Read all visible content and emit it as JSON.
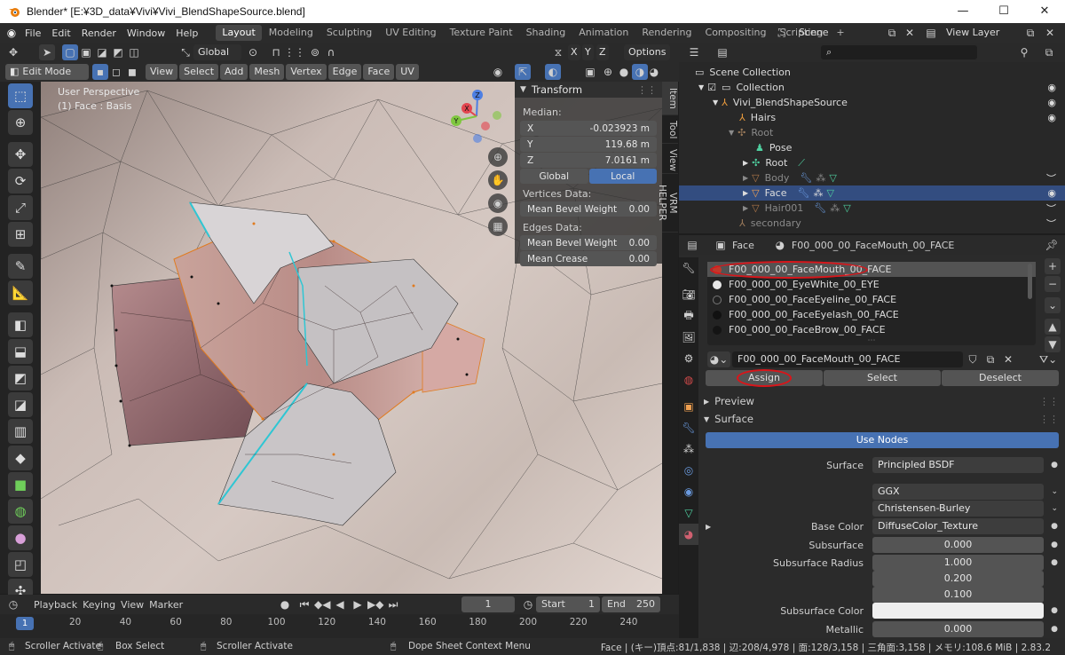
{
  "window": {
    "title": "Blender* [E:¥3D_data¥Vivi¥Vivi_BlendShapeSource.blend]",
    "controls": [
      "—",
      "☐",
      "✕"
    ]
  },
  "topbar": {
    "menus": [
      "File",
      "Edit",
      "Render",
      "Window",
      "Help"
    ],
    "workspaces": [
      "Layout",
      "Modeling",
      "Sculpting",
      "UV Editing",
      "Texture Paint",
      "Shading",
      "Animation",
      "Rendering",
      "Compositing",
      "Scripting"
    ],
    "active_workspace": "Layout",
    "add_tab": "+",
    "scene_label": "Scene",
    "view_layer_label": "View Layer"
  },
  "viewport_header": {
    "orientation": "Global",
    "options": "Options",
    "axes": [
      "X",
      "Y",
      "Z"
    ],
    "mode": "Edit Mode",
    "menus": [
      "View",
      "Select",
      "Add",
      "Mesh",
      "Vertex",
      "Edge",
      "Face",
      "UV"
    ]
  },
  "viewport": {
    "overlay_title": "User Perspective",
    "overlay_sub": "(1) Face : Basis",
    "gizmo": {
      "z": "Z",
      "x": "X",
      "y": "Y"
    }
  },
  "npanel": {
    "header": "Transform",
    "median_label": "Median:",
    "fields": [
      {
        "axis": "X",
        "value": "-0.023923 m"
      },
      {
        "axis": "Y",
        "value": "119.68 m"
      },
      {
        "axis": "Z",
        "value": "7.0161 m"
      }
    ],
    "space_global": "Global",
    "space_local": "Local",
    "vertices_data_label": "Vertices Data:",
    "vertex_bevel": {
      "label": "Mean Bevel Weight",
      "value": "0.00"
    },
    "edges_data_label": "Edges Data:",
    "edge_bevel": {
      "label": "Mean Bevel Weight",
      "value": "0.00"
    },
    "edge_crease": {
      "label": "Mean Crease",
      "value": "0.00"
    },
    "tabs": [
      "Item",
      "Tool",
      "View",
      "VRM HELPER"
    ]
  },
  "outliner": {
    "rows": [
      {
        "label": "Scene Collection",
        "indent": 0,
        "icon": "collection-icon",
        "dim": false
      },
      {
        "label": "Collection",
        "indent": 1,
        "icon": "collection-icon",
        "dim": false
      },
      {
        "label": "Vivi_BlendShapeSource",
        "indent": 2,
        "icon": "empty-icon",
        "dim": false
      },
      {
        "label": "Hairs",
        "indent": 3,
        "icon": "empty-icon",
        "dim": false
      },
      {
        "label": "Root",
        "indent": 3,
        "icon": "armature-icon",
        "dim": true
      },
      {
        "label": "Pose",
        "indent": 4,
        "icon": "pose-icon",
        "dim": false
      },
      {
        "label": "Root",
        "indent": 4,
        "icon": "armature-icon",
        "dim": false
      },
      {
        "label": "Body",
        "indent": 4,
        "icon": "mesh-icon",
        "dim": true
      },
      {
        "label": "Face",
        "indent": 4,
        "icon": "mesh-icon",
        "dim": false,
        "selected": true
      },
      {
        "label": "Hair001",
        "indent": 4,
        "icon": "mesh-icon",
        "dim": true
      },
      {
        "label": "secondary",
        "indent": 3,
        "icon": "empty-icon",
        "dim": true
      }
    ]
  },
  "properties": {
    "breadcrumb_object": "Face",
    "breadcrumb_material": "F00_000_00_FaceMouth_00_FACE",
    "slots": [
      {
        "name": "F00_000_00_FaceMouth_00_FACE",
        "color": "#c0392b"
      },
      {
        "name": "F00_000_00_EyeWhite_00_EYE",
        "color": "#e8e8e8"
      },
      {
        "name": "F00_000_00_FaceEyeline_00_FACE",
        "color": "#222222"
      },
      {
        "name": "F00_000_00_FaceEyelash_00_FACE",
        "color": "#111111"
      },
      {
        "name": "F00_000_00_FaceBrow_00_FACE",
        "color": "#141414"
      }
    ],
    "material_name": "F00_000_00_FaceMouth_00_FACE",
    "assign": "Assign",
    "select": "Select",
    "deselect": "Deselect",
    "preview": "Preview",
    "surface_section": "Surface",
    "use_nodes": "Use Nodes",
    "surface": {
      "label": "Surface",
      "value": "Principled BSDF"
    },
    "distribution": "GGX",
    "subsurface_method": "Christensen-Burley",
    "base_color": {
      "label": "Base Color",
      "value": "DiffuseColor_Texture"
    },
    "subsurface": {
      "label": "Subsurface",
      "value": "0.000"
    },
    "subsurface_radius": {
      "label": "Subsurface Radius",
      "values": [
        "1.000",
        "0.200",
        "0.100"
      ]
    },
    "subsurface_color": {
      "label": "Subsurface Color"
    },
    "metallic": {
      "label": "Metallic",
      "value": "0.000"
    }
  },
  "timeline": {
    "menus": [
      "Playback",
      "Keying",
      "View",
      "Marker"
    ],
    "current_frame": "1",
    "start_label": "Start",
    "start": "1",
    "end_label": "End",
    "end": "250",
    "ticks": [
      "1",
      "20",
      "40",
      "60",
      "80",
      "100",
      "120",
      "140",
      "160",
      "180",
      "200",
      "220",
      "240"
    ]
  },
  "statusbar": {
    "left": [
      "Scroller Activate",
      "Box Select",
      "Scroller Activate",
      "Dope Sheet Context Menu"
    ],
    "right": "Face | (キー)頂点:81/1,838 | 辺:208/4,978 | 面:128/3,158 | 三角面:3,158 | メモリ:108.6 MiB | 2.83.2"
  }
}
